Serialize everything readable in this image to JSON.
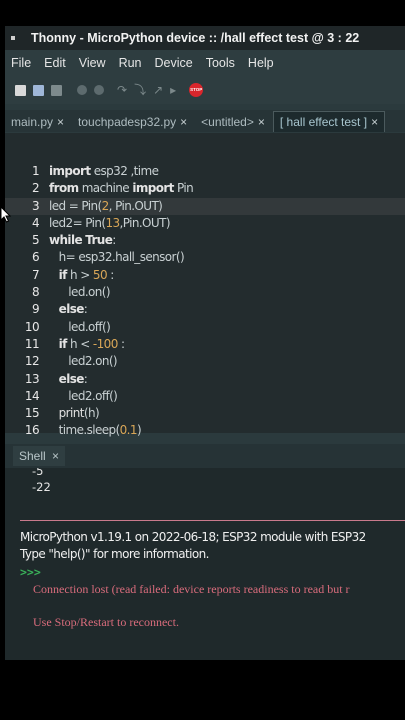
{
  "window": {
    "title": "Thonny  -  MicroPython device :: /hall effect test  @  3 : 22"
  },
  "menu": [
    "File",
    "Edit",
    "View",
    "Run",
    "Device",
    "Tools",
    "Help"
  ],
  "toolbar": {
    "icons": [
      "new-file-icon",
      "open-file-icon",
      "save-file-icon",
      "run-icon",
      "debug-icon",
      "step-over-icon",
      "step-into-icon",
      "step-out-icon",
      "resume-icon",
      "stop-icon"
    ],
    "stop_label": "STOP",
    "stop_color": "#d9262c"
  },
  "tabs": [
    {
      "label": "main.py",
      "close": "×",
      "active": false
    },
    {
      "label": "touchpadesp32.py",
      "close": "×",
      "active": false
    },
    {
      "label": "<untitled>",
      "close": "×",
      "active": false
    },
    {
      "label": "[ hall effect test ]",
      "close": "×",
      "active": true
    }
  ],
  "editor": {
    "current_line": 3,
    "lines": [
      {
        "n": "1",
        "indent": "",
        "parts": [
          {
            "t": "kw",
            "v": "import"
          },
          {
            "t": "txt",
            "v": " esp32 ,time"
          }
        ]
      },
      {
        "n": "2",
        "indent": "",
        "parts": [
          {
            "t": "kw",
            "v": "from"
          },
          {
            "t": "txt",
            "v": " machine "
          },
          {
            "t": "kw",
            "v": "import"
          },
          {
            "t": "txt",
            "v": " Pin"
          }
        ]
      },
      {
        "n": "3",
        "indent": "",
        "parts": [
          {
            "t": "txt",
            "v": "led = Pin("
          },
          {
            "t": "num",
            "v": "2"
          },
          {
            "t": "txt",
            "v": ", Pin.OUT)"
          }
        ]
      },
      {
        "n": "4",
        "indent": "",
        "parts": [
          {
            "t": "txt",
            "v": "led2= Pin("
          },
          {
            "t": "num",
            "v": "13"
          },
          {
            "t": "txt",
            "v": ",Pin.OUT)"
          }
        ]
      },
      {
        "n": "5",
        "indent": "",
        "parts": [
          {
            "t": "kw",
            "v": "while"
          },
          {
            "t": "txt",
            "v": " "
          },
          {
            "t": "kw",
            "v": "True"
          },
          {
            "t": "txt",
            "v": ":"
          }
        ]
      },
      {
        "n": "6",
        "indent": "   ",
        "parts": [
          {
            "t": "txt",
            "v": "h= esp32.hall_sensor()"
          }
        ]
      },
      {
        "n": "7",
        "indent": "   ",
        "parts": [
          {
            "t": "kw",
            "v": "if"
          },
          {
            "t": "txt",
            "v": " h > "
          },
          {
            "t": "num",
            "v": "50"
          },
          {
            "t": "txt",
            "v": " :"
          }
        ]
      },
      {
        "n": "8",
        "indent": "      ",
        "parts": [
          {
            "t": "txt",
            "v": "led.on()"
          }
        ]
      },
      {
        "n": "9",
        "indent": "   ",
        "parts": [
          {
            "t": "kw",
            "v": "else"
          },
          {
            "t": "txt",
            "v": ":"
          }
        ]
      },
      {
        "n": "10",
        "indent": "      ",
        "parts": [
          {
            "t": "txt",
            "v": "led.off()"
          }
        ]
      },
      {
        "n": "11",
        "indent": "   ",
        "parts": [
          {
            "t": "kw",
            "v": "if"
          },
          {
            "t": "txt",
            "v": " h < "
          },
          {
            "t": "num",
            "v": "-100"
          },
          {
            "t": "txt",
            "v": " :"
          }
        ]
      },
      {
        "n": "12",
        "indent": "      ",
        "parts": [
          {
            "t": "txt",
            "v": "led2.on()"
          }
        ]
      },
      {
        "n": "13",
        "indent": "   ",
        "parts": [
          {
            "t": "kw",
            "v": "else"
          },
          {
            "t": "txt",
            "v": ":"
          }
        ]
      },
      {
        "n": "14",
        "indent": "      ",
        "parts": [
          {
            "t": "txt",
            "v": "led2.off()"
          }
        ]
      },
      {
        "n": "15",
        "indent": "   ",
        "parts": [
          {
            "t": "kw2",
            "v": "print"
          },
          {
            "t": "txt",
            "v": "(h)"
          }
        ]
      },
      {
        "n": "16",
        "indent": "   ",
        "parts": [
          {
            "t": "txt",
            "v": "time.sleep("
          },
          {
            "t": "num",
            "v": "0.1"
          },
          {
            "t": "txt",
            "v": ")"
          }
        ]
      }
    ]
  },
  "shell": {
    "tab_label": "Shell",
    "tab_close": "×",
    "output_partial": "-5",
    "output_last": "-22",
    "banner_line1": "MicroPython v1.19.1 on 2022-06-18; ESP32 module with ESP32",
    "banner_line2": "Type \"help()\" for more information.",
    "prompt": ">>>",
    "error_line1": "Connection lost (read failed: device reports readiness to read but r",
    "error_line2": "Use Stop/Restart to reconnect.",
    "error_color": "#d96c7c",
    "prompt_color": "#3ab35a"
  }
}
